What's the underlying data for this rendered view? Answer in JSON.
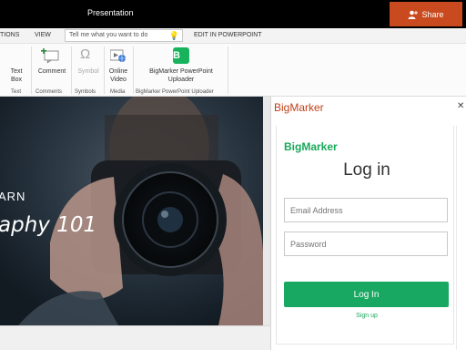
{
  "window": {
    "title": "Presentation",
    "share_label": "Share"
  },
  "menu": {
    "tabs": [
      "TIONS",
      "VIEW",
      "EDIT IN POWERPOINT"
    ],
    "tell_me_placeholder": "Tell me what you want to do"
  },
  "ribbon": {
    "text_group": {
      "button": "Text Box",
      "label": "Text"
    },
    "comments_group": {
      "button": "Comment",
      "label": "Comments"
    },
    "symbols_group": {
      "button": "Symbol",
      "label": "Symbols"
    },
    "media_group": {
      "button": "Online Video",
      "label": "Media"
    },
    "uploader_group": {
      "button": "BigMarker PowerPoint Uploader",
      "label": "BigMarker PowerPoint Uploader",
      "icon_letter": "B"
    }
  },
  "slide": {
    "line1": "ARN",
    "line2": "aphy 101"
  },
  "addin_pane": {
    "title": "BigMarker",
    "logo": "BigMarker",
    "heading": "Log in",
    "email_placeholder": "Email Address",
    "password_placeholder": "Password",
    "login_label": "Log In",
    "signup_label": "Sign up"
  },
  "colors": {
    "share": "#c94a1f",
    "brand_green": "#18a861",
    "pane_title": "#c0401a"
  }
}
